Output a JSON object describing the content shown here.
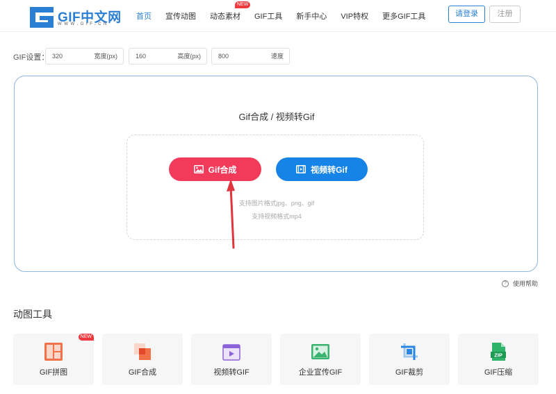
{
  "logo": {
    "main": "GIF中文网",
    "sub": "WWW.GIF.CN"
  },
  "nav": {
    "items": [
      {
        "label": "首页",
        "active": true
      },
      {
        "label": "宣传动图"
      },
      {
        "label": "动态素材",
        "badge": "NEW"
      },
      {
        "label": "GIF工具"
      },
      {
        "label": "新手中心"
      },
      {
        "label": "VIP特权"
      },
      {
        "label": "更多GIF工具"
      }
    ],
    "login": "请登录",
    "register": "注册"
  },
  "settings": {
    "label": "GIF设置：",
    "width": {
      "value": "320",
      "unit": "宽度(px)"
    },
    "height": {
      "value": "160",
      "unit": "高度(px)"
    },
    "speed": {
      "value": "800",
      "unit": "速度"
    }
  },
  "upload": {
    "title": "Gif合成 / 视频转Gif",
    "gif_button": "Gif合成",
    "video_button": "视频转Gif",
    "hint_image": "支持图片格式jpg、png、gif",
    "hint_video": "支持视频格式mp4"
  },
  "help": {
    "label": "使用帮助"
  },
  "tools": {
    "title": "动图工具",
    "items": [
      {
        "label": "GIF拼图",
        "badge": "NEW",
        "icon": "puzzle-icon"
      },
      {
        "label": "GIF合成",
        "icon": "merge-icon"
      },
      {
        "label": "视频转GIF",
        "icon": "video-icon"
      },
      {
        "label": "企业宣传GIF",
        "icon": "image-icon"
      },
      {
        "label": "GIF裁剪",
        "icon": "crop-icon"
      },
      {
        "label": "GIF压缩",
        "icon": "zip-icon"
      }
    ]
  },
  "colors": {
    "accent": "#2a7fd4",
    "gif_button": "#f23a5b",
    "video_button": "#1684e6",
    "annotation_arrow": "#e0353f"
  }
}
